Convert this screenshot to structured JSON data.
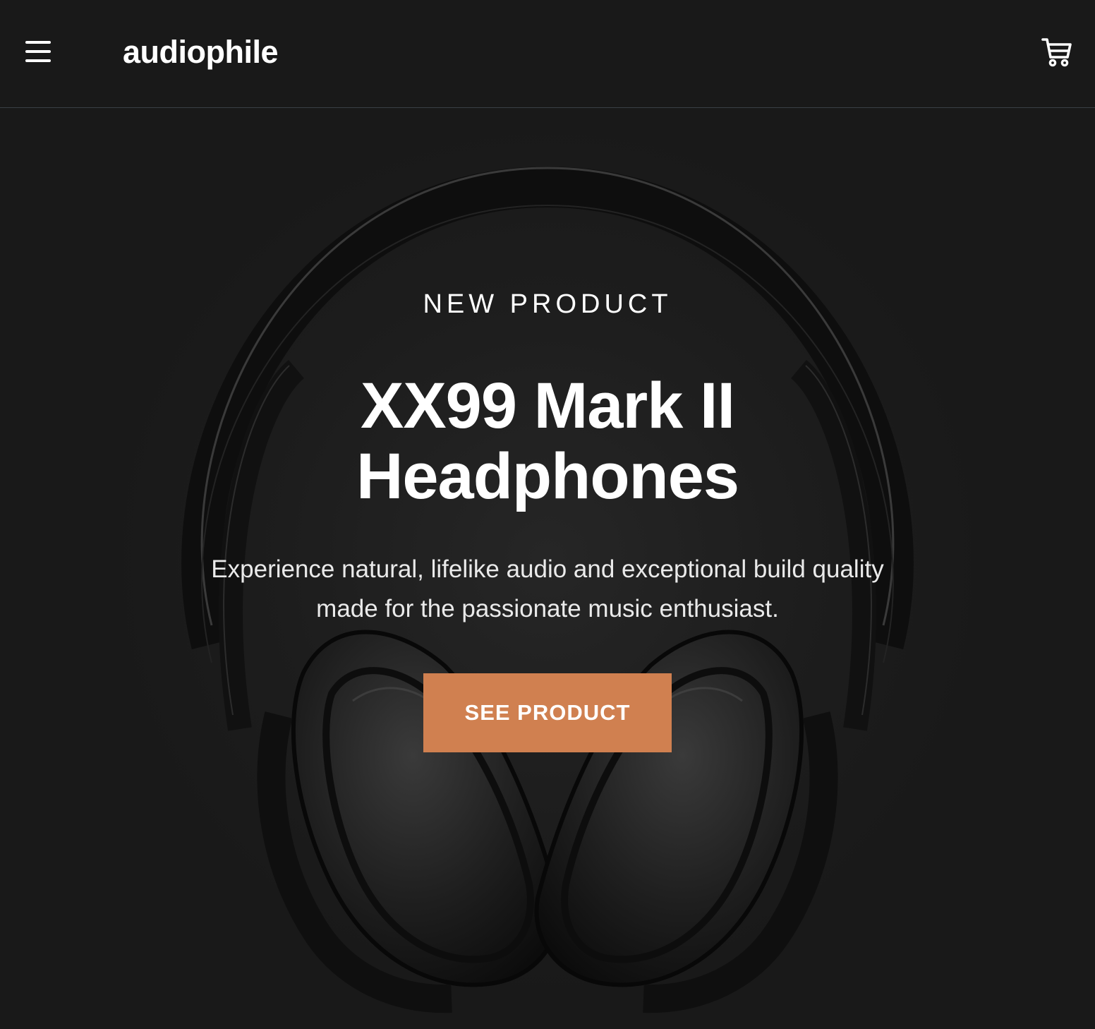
{
  "header": {
    "logo": "audiophile",
    "menu_icon": "hamburger-menu-icon",
    "cart_icon": "shopping-cart-icon"
  },
  "hero": {
    "overline": "NEW PRODUCT",
    "title_line1": "XX99 Mark II",
    "title_line2": "Headphones",
    "description": "Experience natural, lifelike audio and exceptional build quality made for the passionate music enthusiast.",
    "cta_label": "SEE PRODUCT",
    "image": "headphones-photo"
  },
  "colors": {
    "background": "#191919",
    "accent": "#D87D4A",
    "text": "#FFFFFF"
  }
}
